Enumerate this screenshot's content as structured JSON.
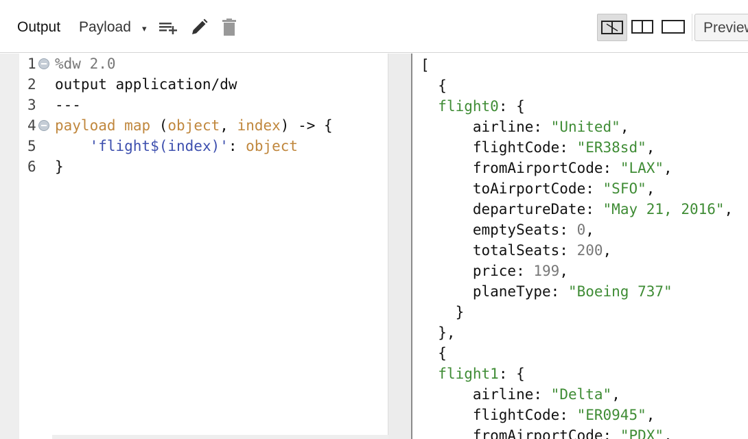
{
  "toolbar": {
    "title": "Output",
    "selector": "Payload",
    "caret": "▾",
    "preview_label": "Preview",
    "icons": [
      "add-list-icon",
      "pencil-icon",
      "trash-icon"
    ],
    "layout_options": [
      "split-horizontal-icon",
      "split-vertical-icon",
      "single-pane-icon"
    ],
    "active_layout": "split-horizontal-icon"
  },
  "editor": {
    "line_numbers": [
      "1",
      "2",
      "3",
      "4",
      "5",
      "6"
    ],
    "lines": [
      {
        "dir": "%dw 2.0"
      },
      {
        "plain": "output application/dw"
      },
      {
        "plain": "---"
      },
      {
        "kw1": "payload",
        "sp1": " ",
        "kw2": "map",
        "p1": " (",
        "kw3": "object",
        "p2": ", ",
        "kw4": "index",
        "p3": ") -> {"
      },
      {
        "indent": "    ",
        "str": "'flight$(index)'",
        "p1": ": ",
        "kw": "object"
      },
      {
        "plain": "}"
      }
    ]
  },
  "output": {
    "lines": [
      {
        "t": "["
      },
      {
        "t": "  {"
      },
      {
        "k": "flight0",
        "s": ": {"
      },
      {
        "k": "airline",
        "v": "\"United\"",
        "e": ","
      },
      {
        "k": "flightCode",
        "v": "\"ER38sd\"",
        "e": ","
      },
      {
        "k": "fromAirportCode",
        "v": "\"LAX\"",
        "e": ","
      },
      {
        "k": "toAirportCode",
        "v": "\"SFO\"",
        "e": ","
      },
      {
        "k": "departureDate",
        "v": "\"May 21, 2016\"",
        "e": ","
      },
      {
        "k": "emptySeats",
        "n": "0",
        "e": ","
      },
      {
        "k": "totalSeats",
        "n": "200",
        "e": ","
      },
      {
        "k": "price",
        "n": "199",
        "e": ","
      },
      {
        "k": "planeType",
        "v": "\"Boeing 737\"",
        "e": ""
      },
      {
        "t": "    }"
      },
      {
        "t": "  },"
      },
      {
        "t": "  {"
      },
      {
        "k": "flight1",
        "s": ": {"
      },
      {
        "k": "airline",
        "v": "\"Delta\"",
        "e": ","
      },
      {
        "k": "flightCode",
        "v": "\"ER0945\"",
        "e": ","
      },
      {
        "k": "fromAirportCode",
        "v": "\"PDX\"",
        "e": ","
      }
    ]
  },
  "colors": {
    "keyword": "#c0873d",
    "string_template": "#3d4fae",
    "json_string": "#3f8c35",
    "json_number": "#777777"
  }
}
